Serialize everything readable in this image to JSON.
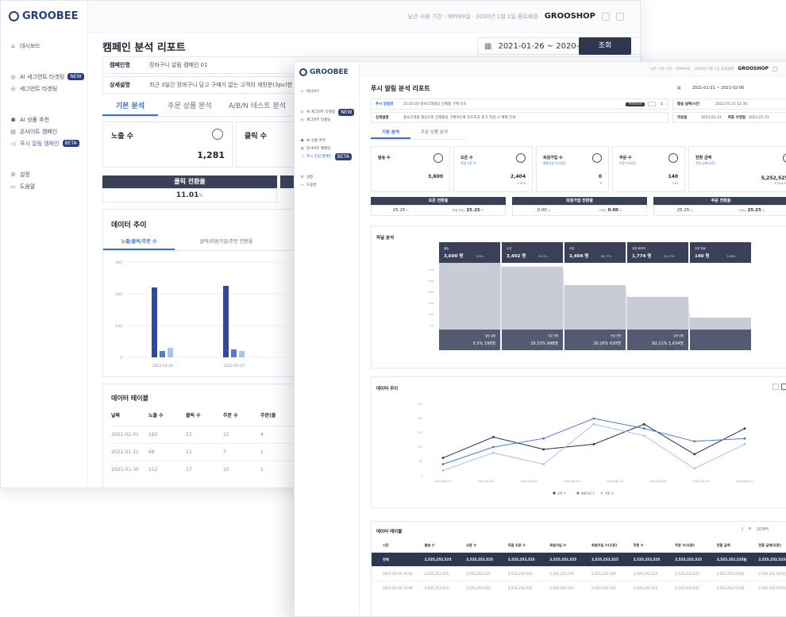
{
  "back": {
    "logo": "GROOBEE",
    "sidebar": [
      {
        "icon": "home-icon",
        "label": "대시보드"
      },
      {
        "icon": "target-icon",
        "label": "AI 세그먼트 타겟팅",
        "badge": "NEW"
      },
      {
        "icon": "target-icon",
        "label": "세그먼트 타겟팅"
      },
      {
        "icon": "robot-icon",
        "label": "AI 상품 추천"
      },
      {
        "icon": "page-icon",
        "label": "온사이트 캠페인"
      },
      {
        "icon": "megaphone-icon",
        "label": "푸시 알림 캠페인",
        "badge": "BETA",
        "active": true
      },
      {
        "icon": "gear-icon",
        "label": "설정"
      },
      {
        "icon": "book-icon",
        "label": "도움말"
      }
    ],
    "topbar": {
      "usage": "남은 사용 기간 : 99999일 · 2030년 1월 1일 종료예정",
      "shop": "GROOSHOP"
    },
    "page_title": "캠페인 분석 리포트",
    "date_range": "2021-01-26 ~ 2020-02-01",
    "search_button": "조회",
    "campaign_label": "캠페인명",
    "campaign_name": "장바구니 알림 캠페인 01",
    "detail_label": "상세설명",
    "detail_text": "최근 3일간 장바구니 담고 구매가 없는 고객의 재방문(3pv)한 경우",
    "tabs": [
      "기본 분석",
      "주문 상품 분석",
      "A/B/N 테스트 분석"
    ],
    "kpi": [
      {
        "label": "노출 수",
        "value": "1,281"
      },
      {
        "label": "클릭 수",
        "value": ""
      }
    ],
    "conv": {
      "label": "클릭 전환율",
      "value": "11.01",
      "unit": "%"
    },
    "trend_title": "데이터 추이",
    "trend_tabs": [
      "노출/클릭/주문 수",
      "클릭/회원가입/주문 전환율"
    ],
    "chart_data": {
      "type": "bar",
      "categories": [
        "2021-01-26",
        "2021-01-27"
      ],
      "series": [
        {
          "values": [
            220,
            225
          ],
          "color": "#2b4aa0"
        },
        {
          "values": [
            20,
            25
          ],
          "color": "#4f7ad8"
        },
        {
          "values": [
            30,
            20
          ],
          "color": "#a9c2f2"
        }
      ],
      "ylim": [
        0,
        300
      ],
      "yticks": [
        "300",
        "200",
        "100",
        "0"
      ]
    },
    "table_title": "데이터 테이블",
    "table_cols": [
      "날짜",
      "노출 수",
      "클릭 수",
      "주문 수",
      "주문(클"
    ],
    "table_rows": [
      [
        "2021-02-01",
        "182",
        "23",
        "15",
        "4"
      ],
      [
        "2021-01-31",
        "68",
        "11",
        "7",
        "1"
      ],
      [
        "2021-01-30",
        "112",
        "17",
        "10",
        "1"
      ]
    ]
  },
  "front": {
    "logo": "GROOBEE",
    "sidebar": [
      {
        "icon": "home-icon",
        "label": "대시보드"
      },
      {
        "icon": "target-icon",
        "label": "AI 세그먼트 타겟팅",
        "badge": "NEW"
      },
      {
        "icon": "target-icon",
        "label": "세그먼트 타겟팅"
      },
      {
        "icon": "robot-icon",
        "label": "AI 상품 추천"
      },
      {
        "icon": "page-icon",
        "label": "온사이트 캠페인"
      },
      {
        "icon": "megaphone-icon",
        "label": "푸시 알림 캠페인",
        "badge": "BETA",
        "active": true
      },
      {
        "icon": "gear-icon",
        "label": "설정"
      },
      {
        "icon": "book-icon",
        "label": "도움말"
      }
    ],
    "topbar": {
      "usage": "남은 사용 기간 : 99999일 · 2030년 1월 1일 종료예정",
      "shop": "GROOSHOP"
    },
    "page_title": "푸시 알림 분석 리포트",
    "date_range": "2021-01-31 ~ 2021-02-06",
    "push_label": "푸시 알림명",
    "push_name": "21.02.03 홍보고객대상 신제품 구매 유도",
    "os_badge": "Android",
    "sent_label": "발송 날짜/시간",
    "sent_value": "2021.01.31 12:34",
    "detail_label": "상세설명",
    "detail_text": "홍보고객을 대상으로 신제품을 구매하도록 유도하고 후기 작성 시 혜택 안내",
    "author_label": "작성일",
    "author_value": "2021.01.31",
    "edited_label": "최종 수정일",
    "edited_value": "2021.01.31",
    "tabs": [
      "기본 분석",
      "주문 상품 분석"
    ],
    "kpis": [
      {
        "label": "발송 수",
        "sub": "",
        "value": "3,600",
        "sub2": "",
        "icon": "send-icon"
      },
      {
        "label": "오픈 수",
        "sub": "직접 오픈 수",
        "value": "2,404",
        "sub2": "1,525",
        "icon": "open-icon"
      },
      {
        "label": "회원가입 수",
        "sub": "회원가입 수(오픈)",
        "value": "0",
        "sub2": "0",
        "icon": "user-icon"
      },
      {
        "label": "주문 수",
        "sub": "주문 수(오픈)",
        "value": "140",
        "sub2": "140",
        "icon": "cart-icon"
      },
      {
        "label": "전환 금액",
        "sub": "전환 금액(오픈)",
        "value": "5,252,525원",
        "sub2": "4,222,525원",
        "icon": "won-icon"
      }
    ],
    "convs": [
      {
        "label": "오픈 전환율",
        "left": "25.25",
        "right_label": "(직접 오픈)",
        "right": "25.25"
      },
      {
        "label": "회원가입 전환율",
        "left": "0.00",
        "right_label": "(오픈)",
        "right": "0.00"
      },
      {
        "label": "주문 전환율",
        "left": "25.25",
        "right_label": "(오픈)",
        "right": "25.25"
      }
    ],
    "funnel_title": "퍼널 분석",
    "funnel": [
      {
        "label": "발송",
        "value": "3,600",
        "unit": "명",
        "pct": "100%",
        "level": 1.0
      },
      {
        "label": "수신",
        "value": "3,402",
        "unit": "명",
        "pct": "94.5%",
        "level": 0.945
      },
      {
        "label": "오픈",
        "value": "2,404",
        "unit": "명",
        "pct": "66.77%",
        "level": 0.668
      },
      {
        "label": "주문 페이지",
        "value": "1,774",
        "unit": "명",
        "pct": "49.27%",
        "level": 0.49
      },
      {
        "label": "주문 완료",
        "value": "140",
        "unit": "명",
        "pct": "3.88%",
        "level": 0.18
      }
    ],
    "funnel_drops": [
      {
        "label": "발송 실패",
        "pct": "5.5%",
        "value": "198"
      },
      {
        "label": "오픈 안함",
        "pct": "29.33%",
        "value": "998"
      },
      {
        "label": "관심 안함",
        "pct": "26.26%",
        "value": "630"
      },
      {
        "label": "주문 안함",
        "pct": "92.11%",
        "value": "1,634"
      }
    ],
    "funnel_yticks": [
      "3000",
      "2500",
      "2000",
      "1500",
      "1000",
      "500"
    ],
    "trend_title": "데이터 추이",
    "chart_data": {
      "type": "line",
      "x": [
        "01월 09일 15시",
        "01월 09일 16시",
        "01월 09일 02시",
        "01월 09일 03시",
        "01월 09일 04시",
        "01월 09일 05시",
        "01월 09일 03시",
        "01월 09일 04시"
      ],
      "series": [
        {
          "name": "오픈 수",
          "color": "#1f2d5c",
          "values": [
            62,
            135,
            92,
            110,
            180,
            75,
            165
          ]
        },
        {
          "name": "회원가입 수",
          "color": "#4a78d6",
          "values": [
            40,
            100,
            130,
            200,
            165,
            120,
            130
          ]
        },
        {
          "name": "주문 수",
          "color": "#a9c2f2",
          "values": [
            18,
            80,
            40,
            180,
            140,
            25,
            110
          ]
        }
      ],
      "ylim": [
        0,
        250
      ],
      "yticks": [
        "250",
        "200",
        "150",
        "100",
        "50",
        "0"
      ]
    },
    "table_title": "데이터 테이블",
    "page_size": "10개씩",
    "table_cols": [
      "시간",
      "발송 수",
      "오픈 수",
      "직접 오픈 수",
      "회원가입 수",
      "회원가입 수(오픈)",
      "주문 수",
      "주문 수(오픈)",
      "전환 금액",
      "전환 금액(오픈)"
    ],
    "table_rows": [
      [
        "전체",
        "2,525,252,525",
        "2,525,252,525",
        "2,525,252,525",
        "2,525,252,525",
        "2,525,252,525",
        "2,525,252,525",
        "2,525,252,525",
        "2,525,252,525원",
        "2,525,252,525원"
      ],
      [
        "2021-02-05 15:00",
        "2,525,252,525",
        "2,525,252,525",
        "2,525,252,525",
        "2,525,252,525",
        "2,525,252,525",
        "2,525,252,525",
        "2,525,252,525",
        "2,525,252,525원",
        "2,525,252,525원"
      ],
      [
        "2021-02-05 15:00",
        "2,525,252,525",
        "2,525,252,525",
        "2,525,252,525",
        "2,525,252,525",
        "2,525,252,525",
        "2,525,252,525",
        "2,525,252,525",
        "2,525,252,525원",
        "2,525,252,525원"
      ]
    ]
  }
}
